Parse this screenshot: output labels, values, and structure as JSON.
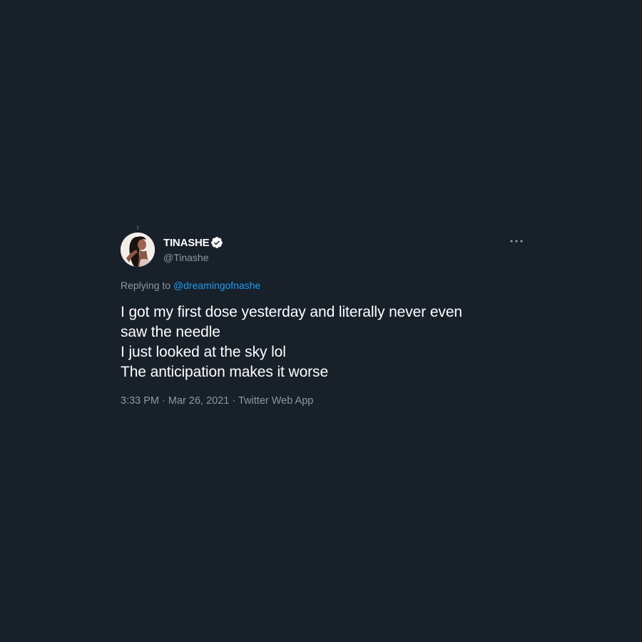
{
  "tweet": {
    "display_name": "TINASHE",
    "handle": "@Tinashe",
    "verified": true,
    "replying_prefix": "Replying to",
    "replying_to": "@dreamingofnashe",
    "lines": [
      "I got my first dose yesterday and literally never even",
      "saw the needle",
      "I just looked at the sky lol",
      "The anticipation makes it worse"
    ],
    "time": "3:33 PM",
    "separator": "·",
    "date": "Mar 26, 2021",
    "source": "Twitter Web App"
  },
  "colors": {
    "background": "#18202a",
    "text_primary": "#ffffff",
    "text_secondary": "#8b98a5",
    "accent": "#1d9bf0"
  },
  "icons": {
    "verified": "verified-badge-icon",
    "more": "more-options-icon"
  }
}
